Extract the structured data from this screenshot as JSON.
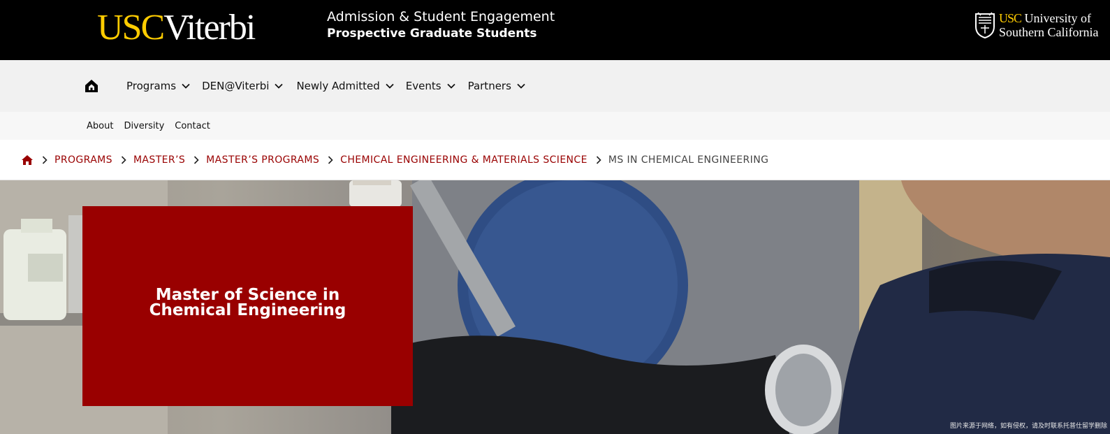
{
  "header": {
    "logo_usc": "USC",
    "logo_viterbi": "Viterbi",
    "tagline_line1": "Admission & Student Engagement",
    "tagline_line2": "Prospective Graduate Students",
    "university_usc": "USC",
    "university_line1_rest": "University of",
    "university_line2": "Southern California"
  },
  "main_nav": {
    "home_icon": "home-icon",
    "items": [
      {
        "label": "Programs"
      },
      {
        "label": "DEN@Viterbi"
      },
      {
        "label": "Newly Admitted"
      },
      {
        "label": "Events"
      },
      {
        "label": "Partners"
      }
    ]
  },
  "sub_nav": {
    "items": [
      {
        "label": "About"
      },
      {
        "label": "Diversity"
      },
      {
        "label": "Contact"
      }
    ]
  },
  "breadcrumb": {
    "home_icon": "home-icon",
    "items": [
      {
        "label": "PROGRAMS"
      },
      {
        "label": "MASTER’S"
      },
      {
        "label": "MASTER’S PROGRAMS"
      },
      {
        "label": "CHEMICAL ENGINEERING & MATERIALS SCIENCE"
      }
    ],
    "current": "MS IN CHEMICAL ENGINEERING"
  },
  "hero": {
    "title": "Master of Science in Chemical Engineering",
    "caption": "图片来源于网络，如有侵权，请及时联系托普仕留学删除"
  },
  "colors": {
    "usc_cardinal": "#990000",
    "usc_gold": "#ffcc00",
    "header_bg": "#000000",
    "nav_bg": "#f1f1f1"
  }
}
